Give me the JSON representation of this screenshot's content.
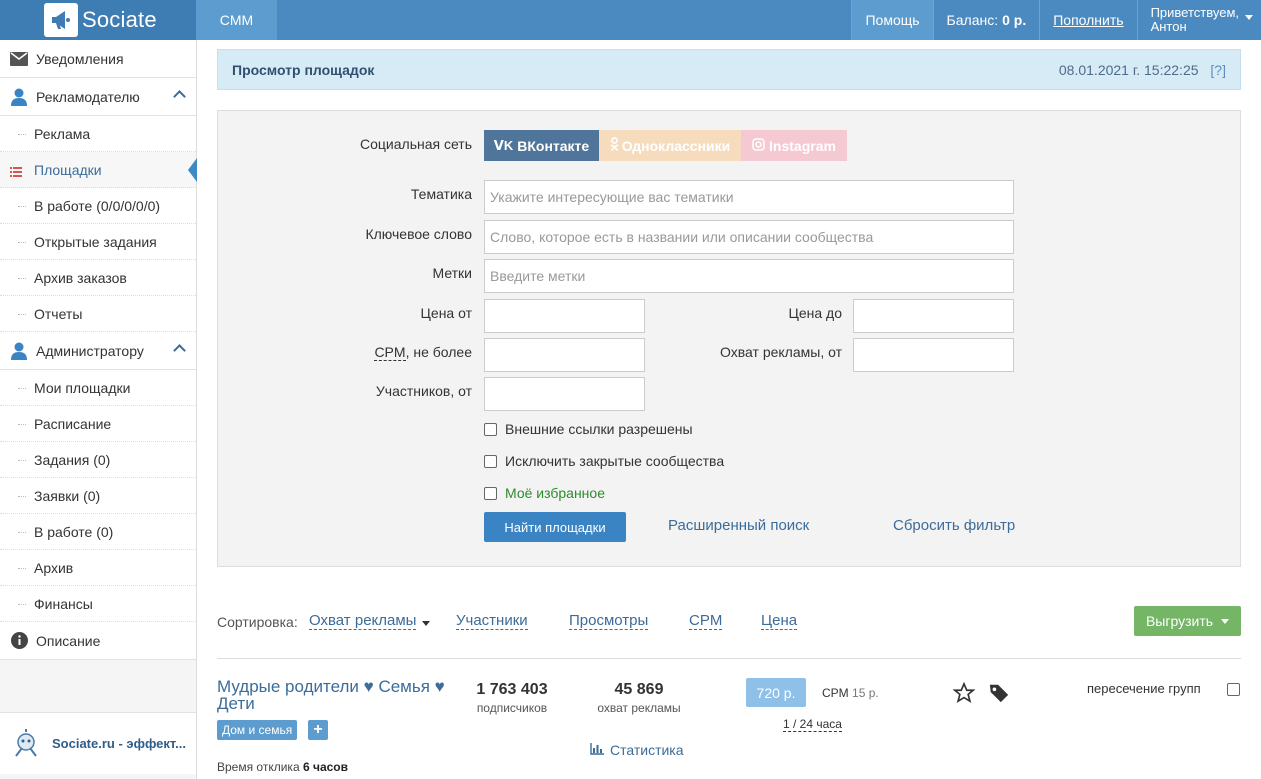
{
  "topbar": {
    "logo_text": "Sociate",
    "nav_item": "CMM",
    "help": "Помощь",
    "balance_label": "Баланс:",
    "balance_value": "0 р.",
    "topup": "Пополнить",
    "greeting": "Приветствуем,",
    "user_name": "Антон"
  },
  "sidebar": {
    "notifications": "Уведомления",
    "advertiser": "Рекламодателю",
    "advertiser_items": [
      "Реклама",
      "Площадки",
      "В работе (0/0/0/0/0)",
      "Открытые задания",
      "Архив заказов",
      "Отчеты"
    ],
    "admin": "Администратору",
    "admin_items": [
      "Мои площадки",
      "Расписание",
      "Задания (0)",
      "Заявки (0)",
      "В работе (0)",
      "Архив",
      "Финансы"
    ],
    "description": "Описание",
    "promo": "Sociate.ru - эффект..."
  },
  "header": {
    "title": "Просмотр площадок",
    "datetime": "08.01.2021 г. 15:22:25",
    "help": "[?]"
  },
  "filter": {
    "social_label": "Социальная сеть",
    "social_vk": "ВКонтакте",
    "social_ok": "Одноклассники",
    "social_ig": "Instagram",
    "topic_label": "Тематика",
    "topic_placeholder": "Укажите интересующие вас тематики",
    "keyword_label": "Ключевое слово",
    "keyword_placeholder": "Слово, которое есть в названии или описании сообщества",
    "tags_label": "Метки",
    "tags_placeholder": "Введите метки",
    "price_from_label": "Цена от",
    "price_to_label": "Цена до",
    "cpm_label_abbr": "CPM",
    "cpm_label_rest": ", не более",
    "reach_label": "Охват рекламы, от",
    "members_label": "Участников, от",
    "check_external": "Внешние ссылки разрешены",
    "check_closed": "Исключить закрытые сообщества",
    "check_favorite": "Моё избранное",
    "find_button": "Найти площадки",
    "advanced_search": "Расширенный поиск",
    "reset_filter": "Сбросить фильтр"
  },
  "sort": {
    "label": "Сортировка:",
    "items": [
      "Охват рекламы",
      "Участники",
      "Просмотры",
      "CPM",
      "Цена"
    ],
    "export_button": "Выгрузить"
  },
  "result": {
    "title": "Мудрые родители ♥ Семья ♥ Дети",
    "tag": "Дом и семья",
    "tag_add": "+",
    "response_label": "Время отклика",
    "response_value": "6 часов",
    "subscribers_value": "1 763 403",
    "subscribers_label": "подписчиков",
    "reach_value": "45 869",
    "reach_label": "охват рекламы",
    "price": "720 р.",
    "cpm_label": "CPM",
    "cpm_value": "15 р.",
    "period": "1 / 24 часа",
    "stats": "Статистика",
    "cross_label": "пересечение групп"
  },
  "colors": {
    "topbar": "#4a8ac0",
    "accent": "#3b84c4",
    "export": "#74b566",
    "favorite": "#2e8b2e"
  }
}
